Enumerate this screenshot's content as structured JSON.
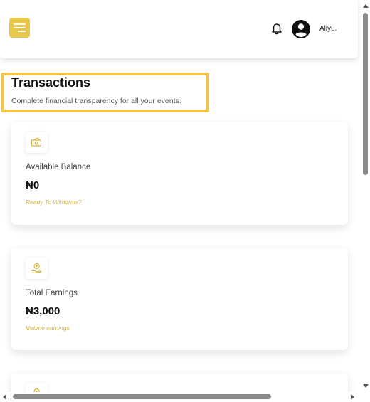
{
  "header": {
    "menu_icon": "hamburger-menu-icon",
    "notification_icon": "bell-icon",
    "avatar_icon": "user-avatar-icon",
    "username": "Aliyu."
  },
  "page": {
    "title": "Transactions",
    "subtitle": "Complete financial transparency for all your events."
  },
  "cards": [
    {
      "icon": "money-icon",
      "label": "Available Balance",
      "value": "₦0",
      "note": "Ready To Withdraw?"
    },
    {
      "icon": "earnings-icon",
      "label": "Total Earnings",
      "value": "₦3,000",
      "note": "lifetime earnings"
    },
    {
      "icon": "earnings-icon"
    }
  ],
  "colors": {
    "accent": "#e8c84a",
    "highlight_border": "#f2c54a",
    "note_text": "#d4b53c"
  }
}
